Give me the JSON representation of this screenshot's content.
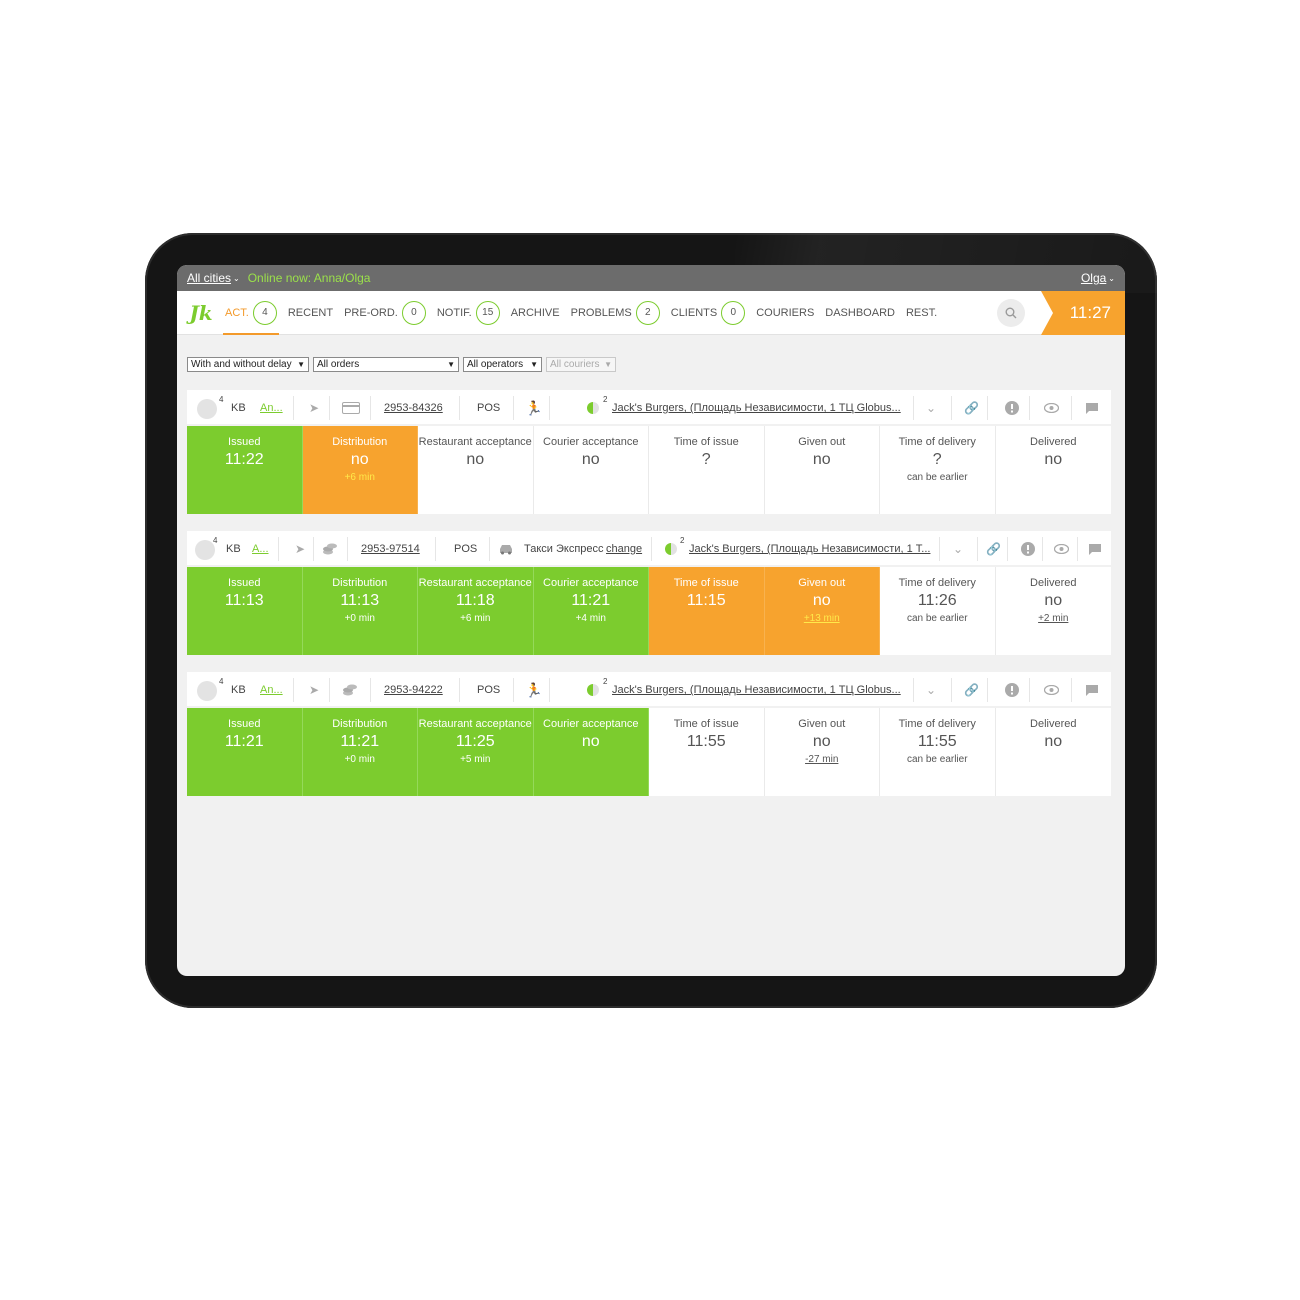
{
  "topbar": {
    "city": "All cities",
    "online": "Online now: Anna/Olga",
    "user": "Olga"
  },
  "nav": {
    "logo": "Jk",
    "tabs": [
      {
        "label": "ACT.",
        "badge": "4"
      },
      {
        "label": "RECENT",
        "badge": null
      },
      {
        "label": "PRE-ORD.",
        "badge": "0"
      },
      {
        "label": "NOTIF.",
        "badge": "15"
      },
      {
        "label": "ARCHIVE",
        "badge": null
      },
      {
        "label": "PROBLEMS",
        "badge": "2"
      },
      {
        "label": "CLIENTS",
        "badge": "0"
      },
      {
        "label": "COURIERS",
        "badge": null
      },
      {
        "label": "DASHBOARD",
        "badge": null
      },
      {
        "label": "REST.",
        "badge": null
      }
    ],
    "time": "11:27"
  },
  "filters": {
    "delay": "With and without delay",
    "orders": "All orders",
    "operators": "All operators",
    "couriers": "All couriers"
  },
  "orders": [
    {
      "count": "4",
      "kb": "KB",
      "operator": "An...",
      "number": "2953-84326",
      "source": "POS",
      "courier": "",
      "change": "",
      "parts": "2",
      "restaurant": "Jack's Burgers, (Площадь Независимости, 1 ТЦ Globus...",
      "cells": [
        {
          "label": "Issued",
          "value": "11:22",
          "sub": ""
        },
        {
          "label": "Distribution",
          "value": "no",
          "sub": "+6 min"
        },
        {
          "label": "Restaurant acceptance",
          "value": "no",
          "sub": ""
        },
        {
          "label": "Courier acceptance",
          "value": "no",
          "sub": ""
        },
        {
          "label": "Time of issue",
          "value": "?",
          "sub": ""
        },
        {
          "label": "Given out",
          "value": "no",
          "sub": ""
        },
        {
          "label": "Time of delivery",
          "value": "?",
          "sub": "can be earlier"
        },
        {
          "label": "Delivered",
          "value": "no",
          "sub": ""
        }
      ]
    },
    {
      "count": "4",
      "kb": "KB",
      "operator": "A...",
      "number": "2953-97514",
      "source": "POS",
      "courier": "Такси Экспресс",
      "change": "change",
      "parts": "2",
      "restaurant": "Jack's Burgers, (Площадь Независимости, 1 Т...",
      "cells": [
        {
          "label": "Issued",
          "value": "11:13",
          "sub": ""
        },
        {
          "label": "Distribution",
          "value": "11:13",
          "sub": "+0 min"
        },
        {
          "label": "Restaurant acceptance",
          "value": "11:18",
          "sub": "+6 min"
        },
        {
          "label": "Courier acceptance",
          "value": "11:21",
          "sub": "+4 min"
        },
        {
          "label": "Time of issue",
          "value": "11:15",
          "sub": ""
        },
        {
          "label": "Given out",
          "value": "no",
          "sub": "+13 min"
        },
        {
          "label": "Time of delivery",
          "value": "11:26",
          "sub": "can be earlier"
        },
        {
          "label": "Delivered",
          "value": "no",
          "sub": "+2 min"
        }
      ]
    },
    {
      "count": "4",
      "kb": "KB",
      "operator": "An...",
      "number": "2953-94222",
      "source": "POS",
      "courier": "",
      "change": "",
      "parts": "2",
      "restaurant": "Jack's Burgers, (Площадь Независимости, 1 ТЦ Globus...",
      "cells": [
        {
          "label": "Issued",
          "value": "11:21",
          "sub": ""
        },
        {
          "label": "Distribution",
          "value": "11:21",
          "sub": "+0 min"
        },
        {
          "label": "Restaurant acceptance",
          "value": "11:25",
          "sub": "+5 min"
        },
        {
          "label": "Courier acceptance",
          "value": "no",
          "sub": ""
        },
        {
          "label": "Time of issue",
          "value": "11:55",
          "sub": ""
        },
        {
          "label": "Given out",
          "value": "no",
          "sub": "-27 min"
        },
        {
          "label": "Time of delivery",
          "value": "11:55",
          "sub": "can be earlier"
        },
        {
          "label": "Delivered",
          "value": "no",
          "sub": ""
        }
      ]
    }
  ],
  "colors": {
    "green": "#7ccc2e",
    "orange": "#f7a32e"
  }
}
